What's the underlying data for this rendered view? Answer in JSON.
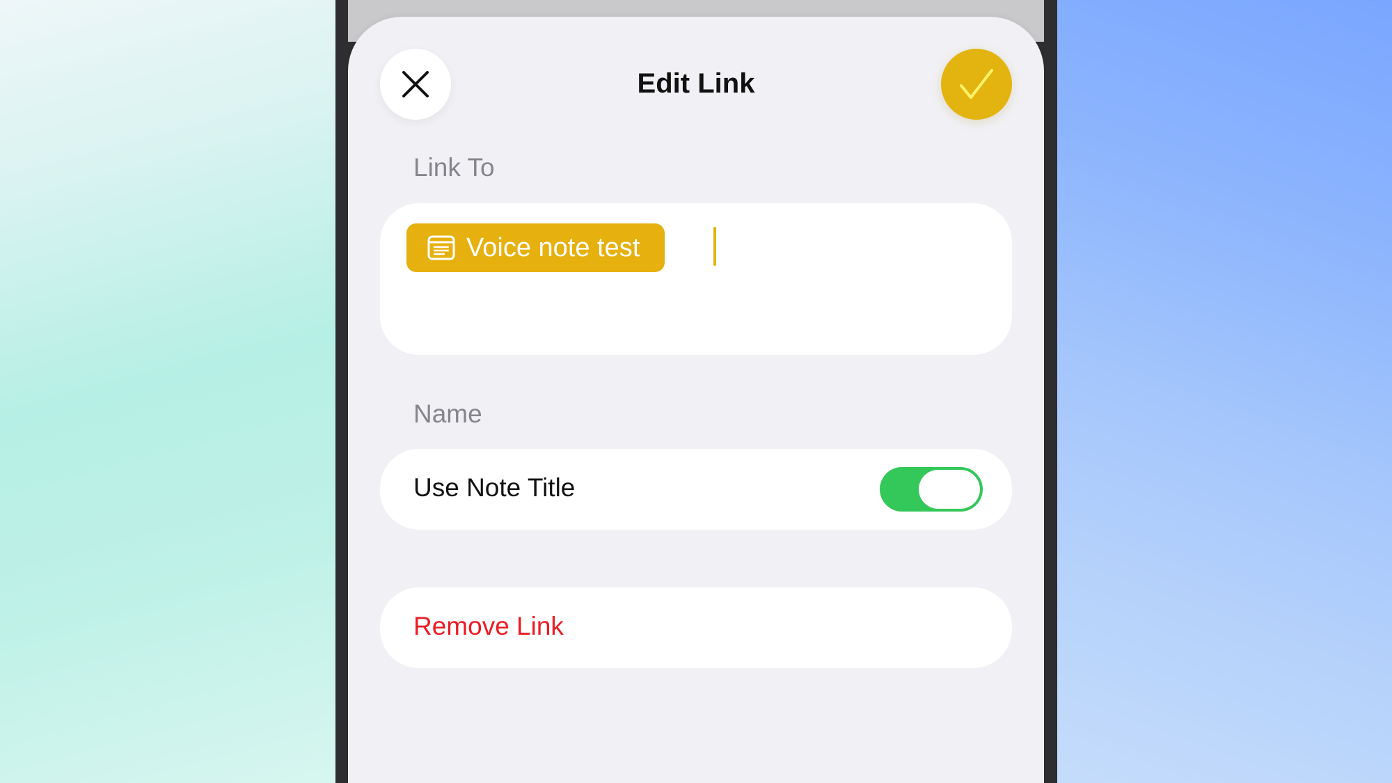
{
  "sheet": {
    "title": "Edit Link",
    "close_icon": "close-icon",
    "done_icon": "checkmark-icon"
  },
  "link_to": {
    "label": "Link To",
    "chip_text": "Voice note test",
    "chip_icon": "note-icon"
  },
  "name": {
    "label": "Name",
    "use_note_title_label": "Use Note Title",
    "use_note_title_on": true
  },
  "remove": {
    "label": "Remove Link"
  },
  "colors": {
    "accent": "#e3b40f",
    "toggle_on": "#34c759",
    "destructive": "#ec1c24"
  }
}
